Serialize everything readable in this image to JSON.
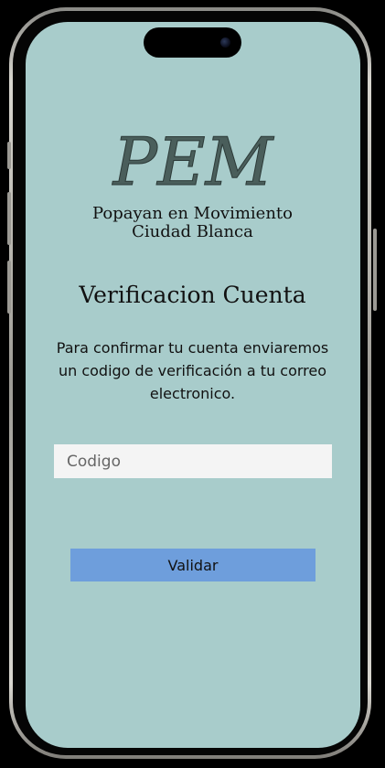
{
  "logo": {
    "text": "PEM",
    "tagline_line1": "Popayan en Movimiento",
    "tagline_line2": "Ciudad Blanca"
  },
  "screen": {
    "title": "Verificacion Cuenta",
    "message": "Para confirmar tu cuenta enviaremos un codigo de verificación a tu correo electronico."
  },
  "form": {
    "code_placeholder": "Codigo",
    "code_value": "",
    "submit_label": "Validar"
  },
  "colors": {
    "background": "#a8cccb",
    "button": "#6e9edc",
    "input": "#f4f4f4"
  }
}
